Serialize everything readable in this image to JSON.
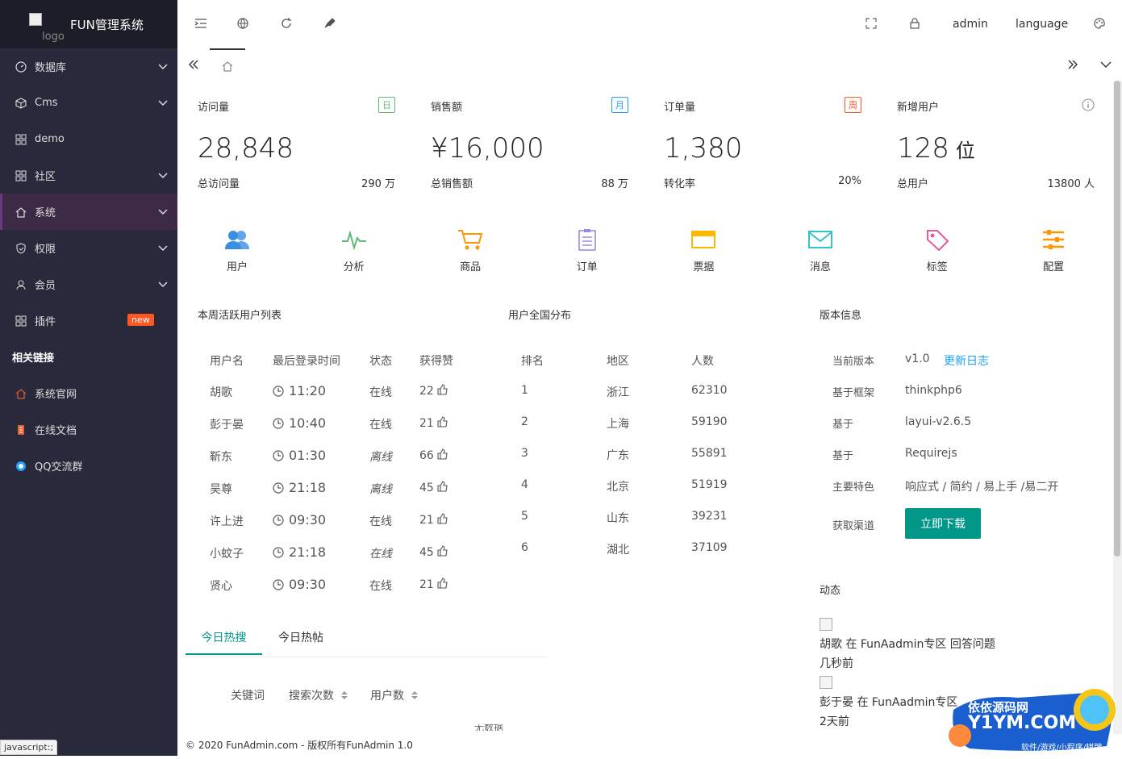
{
  "app": {
    "logo_alt": "logo",
    "title": "FUN管理系统"
  },
  "sidebar": {
    "items": [
      {
        "label": "数据库",
        "icon": "gauge-icon",
        "chev": true
      },
      {
        "label": "Cms",
        "icon": "cube-icon",
        "chev": true
      },
      {
        "label": "demo",
        "icon": "grid-icon",
        "chev": false
      },
      {
        "label": "社区",
        "icon": "grid-icon",
        "chev": true
      },
      {
        "label": "系统",
        "icon": "home-icon",
        "chev": true,
        "active": true
      },
      {
        "label": "权限",
        "icon": "shield-icon",
        "chev": true
      },
      {
        "label": "会员",
        "icon": "user-icon",
        "chev": true
      },
      {
        "label": "插件",
        "icon": "grid-icon",
        "chev": false,
        "badge": "new"
      }
    ],
    "section": "相关链接",
    "links": [
      {
        "label": "系统官网",
        "icon": "home-icon"
      },
      {
        "label": "在线文档",
        "icon": "doc-icon"
      },
      {
        "label": "QQ交流群",
        "icon": "qq-icon"
      }
    ]
  },
  "statusbar": "javascript:;",
  "topbar": {
    "user": "admin",
    "language": "language"
  },
  "cards": [
    {
      "label": "访问量",
      "tag": "日",
      "tag_color": "#5FB878",
      "value": "28,848",
      "unit": "",
      "sub": "总访问量",
      "subv": "290 万"
    },
    {
      "label": "销售额",
      "tag": "月",
      "tag_color": "#1E9FFF",
      "value": "¥16,000",
      "unit": "",
      "sub": "总销售额",
      "subv": "88 万"
    },
    {
      "label": "订单量",
      "tag": "周",
      "tag_color": "#FF5722",
      "value": "1,380",
      "unit": "",
      "sub": "转化率",
      "subv": "20%"
    },
    {
      "label": "新增用户",
      "tag": "",
      "tag_color": "",
      "value": "128",
      "unit": "位",
      "sub": "总用户",
      "subv": "13800 人"
    }
  ],
  "shortcuts": [
    {
      "label": "用户",
      "icon": "users-icon",
      "color": "#3a8ee6"
    },
    {
      "label": "分析",
      "icon": "pulse-icon",
      "color": "#5FB878"
    },
    {
      "label": "商品",
      "icon": "cart-icon",
      "color": "#FF9800"
    },
    {
      "label": "订单",
      "icon": "clipboard-icon",
      "color": "#9b8be0"
    },
    {
      "label": "票据",
      "icon": "card-icon",
      "color": "#FFB800"
    },
    {
      "label": "消息",
      "icon": "mail-icon",
      "color": "#2ec7c9"
    },
    {
      "label": "标签",
      "icon": "tag-icon",
      "color": "#e85a9a"
    },
    {
      "label": "配置",
      "icon": "sliders-icon",
      "color": "#FF9800"
    }
  ],
  "active_users": {
    "title": "本周活跃用户列表",
    "headers": [
      "用户名",
      "最后登录时间",
      "状态",
      "获得赞"
    ],
    "rows": [
      {
        "name": "胡歌",
        "time": "11:20",
        "status": "在线",
        "likes": "22",
        "italic": false
      },
      {
        "name": "彭于晏",
        "time": "10:40",
        "status": "在线",
        "likes": "21",
        "italic": false
      },
      {
        "name": "靳东",
        "time": "01:30",
        "status": "离线",
        "likes": "66",
        "italic": true
      },
      {
        "name": "吴尊",
        "time": "21:18",
        "status": "离线",
        "likes": "45",
        "italic": true
      },
      {
        "name": "许上进",
        "time": "09:30",
        "status": "在线",
        "likes": "21",
        "italic": false
      },
      {
        "name": "小蚊子",
        "time": "21:18",
        "status": "在线",
        "likes": "45",
        "italic": true
      },
      {
        "name": "贤心",
        "time": "09:30",
        "status": "在线",
        "likes": "21",
        "italic": false
      }
    ]
  },
  "distribution": {
    "title": "用户全国分布",
    "headers": [
      "排名",
      "地区",
      "人数"
    ],
    "rows": [
      {
        "rank": "1",
        "region": "浙江",
        "count": "62310"
      },
      {
        "rank": "2",
        "region": "上海",
        "count": "59190"
      },
      {
        "rank": "3",
        "region": "广东",
        "count": "55891"
      },
      {
        "rank": "4",
        "region": "北京",
        "count": "51919"
      },
      {
        "rank": "5",
        "region": "山东",
        "count": "39231"
      },
      {
        "rank": "6",
        "region": "湖北",
        "count": "37109"
      }
    ]
  },
  "version": {
    "title": "版本信息",
    "rows": [
      {
        "k": "当前版本",
        "v": "v1.0",
        "link": "更新日志"
      },
      {
        "k": "基于框架",
        "v": "thinkphp6"
      },
      {
        "k": "基于",
        "v": "layui-v2.6.5"
      },
      {
        "k": "基于",
        "v": "Requirejs"
      },
      {
        "k": "主要特色",
        "v": "响应式 / 简约 / 易上手 /易二开"
      },
      {
        "k": "获取渠道",
        "v": ""
      }
    ],
    "download": "立即下载"
  },
  "activity": {
    "title": "动态",
    "items": [
      {
        "text": "胡歌 在 FunAadmin专区 回答问题",
        "time": "几秒前"
      },
      {
        "text": "彭于晏 在 FunAadmin专区",
        "time": "2天前"
      }
    ]
  },
  "hot": {
    "tabs": [
      "今日热搜",
      "今日热帖"
    ],
    "headers": [
      "关键词",
      "搜索次数",
      "用户数"
    ],
    "empty": "无数据"
  },
  "footer": "© 2020 FunAdmin.com - 版权所有FunAdmin 1.0",
  "watermark": {
    "line1": "依依源码网",
    "line2": "Y1YM.COM",
    "line3": "软件/游戏/小程序/棋牌"
  }
}
